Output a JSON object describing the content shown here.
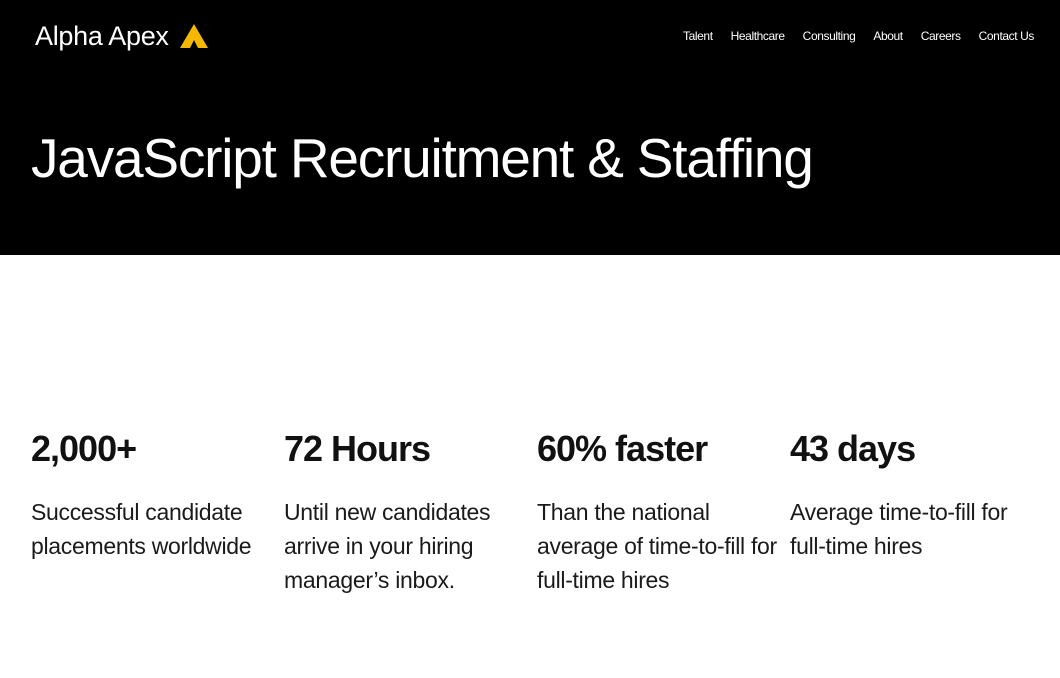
{
  "brand": {
    "name": "Alpha Apex",
    "accent_color": "#F5B800",
    "mark_icon": "apex-triangle-icon"
  },
  "nav": {
    "items": [
      {
        "label": "Talent"
      },
      {
        "label": "Healthcare"
      },
      {
        "label": "Consulting"
      },
      {
        "label": "About"
      },
      {
        "label": "Careers"
      },
      {
        "label": "Contact Us"
      }
    ]
  },
  "hero": {
    "title": "JavaScript Recruitment & Staffing",
    "background": "#000000"
  },
  "stats": [
    {
      "value": "2,000+",
      "description": "Successful candidate placements worldwide"
    },
    {
      "value": "72 Hours",
      "description": "Until new candidates arrive in your hiring manager’s inbox."
    },
    {
      "value": "60% faster",
      "description": "Than the national average of time-to-fill for full-time hires"
    },
    {
      "value": "43 days",
      "description": "Average time-to-fill for full-time hires"
    }
  ]
}
